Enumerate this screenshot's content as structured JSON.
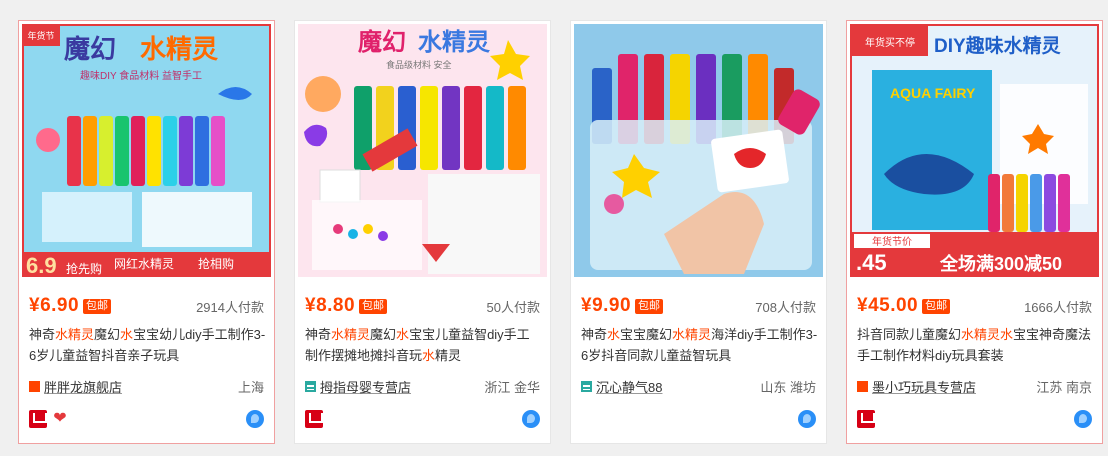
{
  "colors": {
    "accent": "#ff4400",
    "tmall_red": "#d70015",
    "wangwang_blue": "#2a8ff7"
  },
  "products": [
    {
      "thumb": {
        "corner_tag": "年货节",
        "title_a": "魔幻",
        "title_b": "水精灵",
        "sub": "趣味DIY 食品材料 益智手工",
        "bottom_a": "6.9",
        "bottom_b": "抢先购",
        "bottom_c": "网红水精灵",
        "bottom_d": "抢相购"
      },
      "price": "¥6.90",
      "badge": "包邮",
      "sold": "2914人付款",
      "title_parts": [
        "神奇",
        "水精灵",
        "魔幻",
        "水",
        "宝宝幼儿diy手工制作3-6岁儿童益智抖音亲子玩具"
      ],
      "shop": "胖胖龙旗舰店",
      "shop_type": "tmall",
      "location": "上海",
      "icons": [
        "tmall-icon",
        "heart-icon",
        "wangwang-icon"
      ]
    },
    {
      "thumb": {
        "title_a": "魔幻",
        "title_b": "水精灵",
        "sub": "食品级材料 安全"
      },
      "price": "¥8.80",
      "badge": "包邮",
      "sold": "50人付款",
      "title_parts": [
        "神奇",
        "水精灵",
        "魔幻",
        "水",
        "宝宝儿童益智diy手工制作摆摊地摊抖音玩",
        "水",
        "精灵"
      ],
      "shop": "拇指母婴专营店",
      "shop_type": "taobao",
      "location": "浙江 金华",
      "icons": [
        "tmall-icon",
        "wangwang-icon"
      ]
    },
    {
      "thumb": {},
      "price": "¥9.90",
      "badge": "包邮",
      "sold": "708人付款",
      "title_parts": [
        "神奇",
        "水",
        "宝宝魔幻",
        "水精灵",
        "海洋diy手工制作3-6岁抖音同款儿童益智玩具"
      ],
      "shop": "沉心静气88",
      "shop_type": "taobao",
      "location": "山东 潍坊",
      "icons": [
        "wangwang-icon"
      ]
    },
    {
      "thumb": {
        "corner_tag": "年货买不停",
        "title": "DIY趣味水精灵",
        "box_text": "AQUA FAIRY",
        "bottom_tag": "年货节价",
        "bottom_price": ".45",
        "banner": "全场满300减50"
      },
      "price": "¥45.00",
      "badge": "包邮",
      "sold": "1666人付款",
      "title_parts": [
        "抖音同款儿童魔幻",
        "水精灵",
        "水",
        "宝宝神奇魔法手工制作材料diy玩具套装"
      ],
      "shop": "墨小巧玩具专营店",
      "shop_type": "tmall",
      "location": "江苏 南京",
      "icons": [
        "tmall-icon",
        "wangwang-icon"
      ]
    }
  ]
}
